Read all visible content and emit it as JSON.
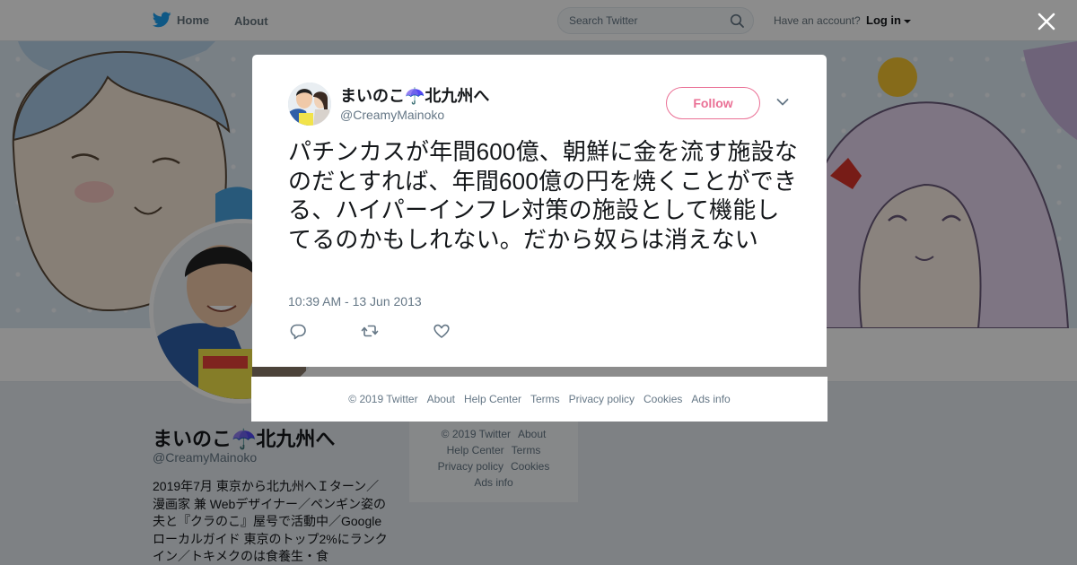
{
  "nav": {
    "home_label": "Home",
    "about_label": "About",
    "search_placeholder": "Search Twitter",
    "have_account": "Have an account?",
    "login_label": "Log in"
  },
  "profile": {
    "name": "まいのこ☂️北九州へ",
    "handle": "@CreamyMainoko",
    "bio": "2019年7月 東京から北九州へＩターン／漫画家 兼 Webデザイナー／ペンギン姿の夫と『クラのこ』屋号で活動中／Googleローカルガイド 東京のトップ2%にランクイン／トキメクのは食養生・食"
  },
  "side_footer": {
    "row1": [
      "© 2019 Twitter",
      "About"
    ],
    "row2": [
      "Help Center",
      "Terms"
    ],
    "row3": [
      "Privacy policy",
      "Cookies"
    ],
    "row4": [
      "Ads info"
    ]
  },
  "tweet": {
    "author_name": "まいのこ☂️北九州へ",
    "author_handle": "@CreamyMainoko",
    "follow_label": "Follow",
    "text": "パチンカスが年間600億、朝鮮に金を流す施設なのだとすれば、年間600億の円を焼くことができる、ハイパーインフレ対策の施設として機能してるのかもしれない。だから奴らは消えない",
    "timestamp": "10:39 AM - 13 Jun 2013",
    "actions": [
      "reply-icon",
      "retweet-icon",
      "like-icon"
    ]
  },
  "modal_footer": [
    "© 2019 Twitter",
    "About",
    "Help Center",
    "Terms",
    "Privacy policy",
    "Cookies",
    "Ads info"
  ],
  "colors": {
    "twitter_blue": "#1da1f2",
    "follow_pink": "#e0245e",
    "text_primary": "#14171a",
    "text_secondary": "#657786"
  }
}
